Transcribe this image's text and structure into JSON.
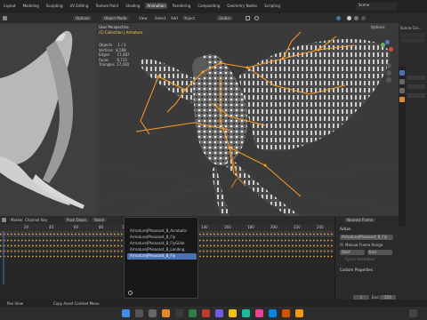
{
  "app": {
    "menu": [
      "Layout",
      "Modeling",
      "Sculpting",
      "UV Editing",
      "Texture Paint",
      "Shading",
      "Animation",
      "Rendering",
      "Compositing",
      "Geometry Nodes",
      "Scripting"
    ],
    "active_tab": "Animation",
    "scene": "Scene"
  },
  "viewport_left": {
    "options": "Options"
  },
  "viewport_main": {
    "mode": "Object Mode",
    "menu": [
      "View",
      "Select",
      "Add",
      "Object"
    ],
    "orientation": "Global",
    "options": "Options",
    "view_title": "User Perspective",
    "collection": "(1) Collection | Armature",
    "stats": [
      {
        "label": "Objects",
        "value": "1 / 3"
      },
      {
        "label": "Vertices",
        "value": "8,508"
      },
      {
        "label": "Edges",
        "value": "17,487"
      },
      {
        "label": "Faces",
        "value": "8,715"
      },
      {
        "label": "Triangles",
        "value": "17,430"
      }
    ]
  },
  "outliner": {
    "item": "Scene Col..."
  },
  "timeline": {
    "menu": [
      "Marker",
      "Channel",
      "Key"
    ],
    "push_down": "Push Down",
    "stash": "Stash",
    "action_field": "Armature|Pheasant_B_Fly",
    "ruler": [
      "20",
      "40",
      "60",
      "80",
      "100",
      "140",
      "160",
      "180",
      "200",
      "220",
      "240",
      "260",
      "280"
    ],
    "dropdown_items": [
      "Armature|Pheasant_B_Acrobatic",
      "Armature|Pheasant_B_Fly",
      "Armature|Pheasant_B_FlyGlide",
      "Armature|Pheasant_B_Landing",
      "Armature|Pheasant_B_Fly"
    ],
    "selected_index": 4
  },
  "side_panel": {
    "header": "Nearest Frame",
    "section": "Action",
    "action_name": "Armature|Pheasant_B_Fly",
    "manual_frame_range": "Manual Frame Range",
    "start_label": "Start",
    "end_label": "End",
    "cyclic": "Cyclic Animation",
    "custom_properties": "Custom Properties",
    "frame_start": "1",
    "end": "End",
    "frame_end": "250"
  },
  "statusbar": {
    "left": "Pan View",
    "right": "Copy Asset Context Menu"
  },
  "colors": {
    "accent": "#4772b3",
    "active_tab": "#474747",
    "keyframe": "#e8a33b",
    "bone": "#ff9b28"
  }
}
